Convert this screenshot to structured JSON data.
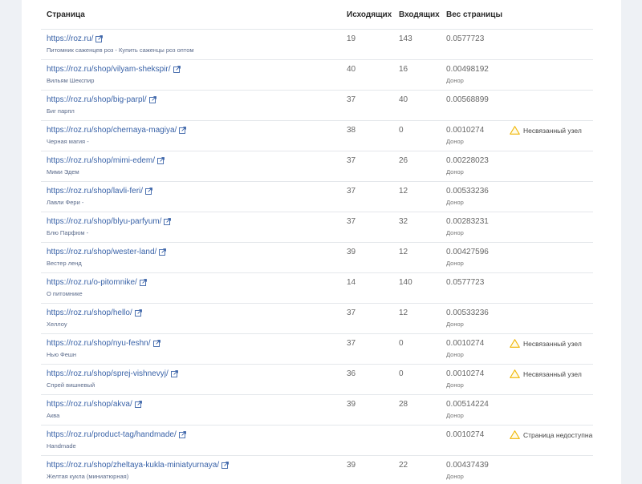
{
  "table": {
    "headers": {
      "page": "Страница",
      "outgoing": "Исходящих",
      "incoming": "Входящих",
      "weight": "Вес страницы"
    },
    "rows": [
      {
        "url": "https://roz.ru/",
        "title": "Питомник саженцев роз - Купить саженцы роз оптом",
        "out": "19",
        "in": "143",
        "weight": "0.0577723",
        "weight_note": "",
        "warning": ""
      },
      {
        "url": "https://roz.ru/shop/vilyam-shekspir/",
        "title": "Вильям Шекспир",
        "out": "40",
        "in": "16",
        "weight": "0.00498192",
        "weight_note": "Донор",
        "warning": ""
      },
      {
        "url": "https://roz.ru/shop/big-parpl/",
        "title": "Биг парпл",
        "out": "37",
        "in": "40",
        "weight": "0.00568899",
        "weight_note": "",
        "warning": ""
      },
      {
        "url": "https://roz.ru/shop/chernaya-magiya/",
        "title": "Черная магия -",
        "out": "38",
        "in": "0",
        "weight": "0.0010274",
        "weight_note": "Донор",
        "warning": "Несвязанный узел"
      },
      {
        "url": "https://roz.ru/shop/mimi-edem/",
        "title": "Мими Эдем",
        "out": "37",
        "in": "26",
        "weight": "0.00228023",
        "weight_note": "Донор",
        "warning": ""
      },
      {
        "url": "https://roz.ru/shop/lavli-feri/",
        "title": "Лавли Фери -",
        "out": "37",
        "in": "12",
        "weight": "0.00533236",
        "weight_note": "Донор",
        "warning": ""
      },
      {
        "url": "https://roz.ru/shop/blyu-parfyum/",
        "title": "Блю Парфюм -",
        "out": "37",
        "in": "32",
        "weight": "0.00283231",
        "weight_note": "Донор",
        "warning": ""
      },
      {
        "url": "https://roz.ru/shop/wester-land/",
        "title": "Вестер ленд",
        "out": "39",
        "in": "12",
        "weight": "0.00427596",
        "weight_note": "Донор",
        "warning": ""
      },
      {
        "url": "https://roz.ru/o-pitomnike/",
        "title": "О питомнике",
        "out": "14",
        "in": "140",
        "weight": "0.0577723",
        "weight_note": "",
        "warning": ""
      },
      {
        "url": "https://roz.ru/shop/hello/",
        "title": "Хеллоу",
        "out": "37",
        "in": "12",
        "weight": "0.00533236",
        "weight_note": "Донор",
        "warning": ""
      },
      {
        "url": "https://roz.ru/shop/nyu-feshn/",
        "title": "Нью Фешн",
        "out": "37",
        "in": "0",
        "weight": "0.0010274",
        "weight_note": "Донор",
        "warning": "Несвязанный узел"
      },
      {
        "url": "https://roz.ru/shop/sprej-vishnevyj/",
        "title": "Спрей вишневый",
        "out": "36",
        "in": "0",
        "weight": "0.0010274",
        "weight_note": "Донор",
        "warning": "Несвязанный узел"
      },
      {
        "url": "https://roz.ru/shop/akva/",
        "title": "Аква",
        "out": "39",
        "in": "28",
        "weight": "0.00514224",
        "weight_note": "Донор",
        "warning": ""
      },
      {
        "url": "https://roz.ru/product-tag/handmade/",
        "title": "Handmade",
        "out": "",
        "in": "",
        "weight": "0.0010274",
        "weight_note": "",
        "warning": "Страница недоступна"
      },
      {
        "url": "https://roz.ru/shop/zheltaya-kukla-miniatyurnaya/",
        "title": "Желтая кукла (миниатюрная)",
        "out": "39",
        "in": "22",
        "weight": "0.00437439",
        "weight_note": "Донор",
        "warning": ""
      }
    ]
  },
  "colors": {
    "link": "#3a63a8",
    "warning": "#f0b400",
    "background": "#eef1f5"
  },
  "icons": {
    "external_link": "external-link-icon",
    "warning": "warning-triangle-icon"
  }
}
